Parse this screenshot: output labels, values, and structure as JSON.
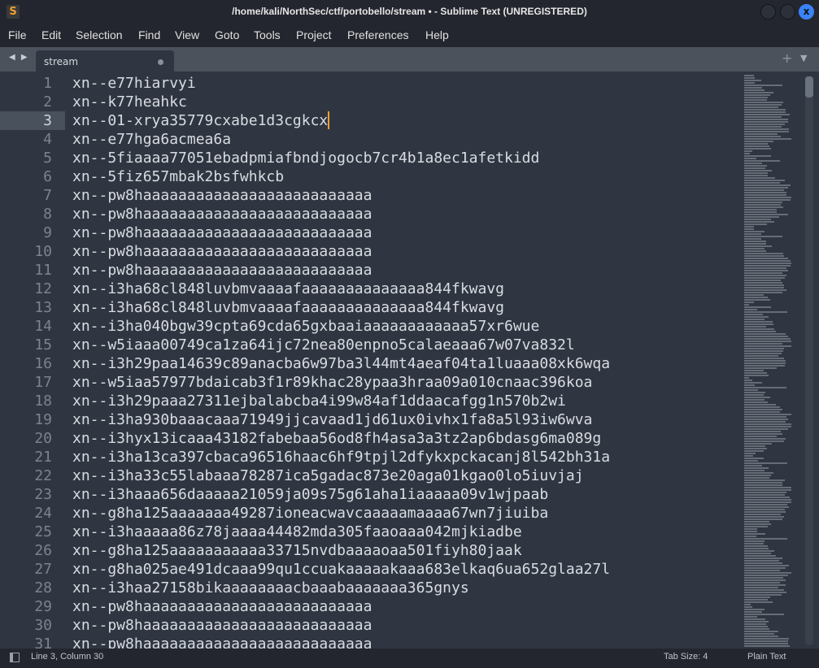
{
  "window": {
    "title": "/home/kali/NorthSec/ctf/portobello/stream • - Sublime Text (UNREGISTERED)",
    "app_icon": "S",
    "close_glyph": "x"
  },
  "menu": [
    "File",
    "Edit",
    "Selection",
    "Find",
    "View",
    "Goto",
    "Tools",
    "Project",
    "Preferences",
    "Help"
  ],
  "tabbar": {
    "nav_arrows": "◀ ▶",
    "tabs": [
      {
        "label": "stream",
        "modified": true
      }
    ],
    "new_tab": "+",
    "tab_menu": "▼"
  },
  "editor": {
    "active_line": 3,
    "lines": [
      {
        "n": "1",
        "text": "xn--e77hiarvyi"
      },
      {
        "n": "2",
        "text": "xn--k77heahkc"
      },
      {
        "n": "3",
        "text": "xn--01-xrya35779cxabe1d3cgkcx"
      },
      {
        "n": "4",
        "text": "xn--e77hga6acmea6a"
      },
      {
        "n": "5",
        "text": "xn--5fiaaaa77051ebadpmiafbndjogocb7cr4b1a8ec1afetkidd"
      },
      {
        "n": "6",
        "text": "xn--5fiz657mbak2bsfwhkcb"
      },
      {
        "n": "7",
        "text": "xn--pw8haaaaaaaaaaaaaaaaaaaaaaaaaa"
      },
      {
        "n": "8",
        "text": "xn--pw8haaaaaaaaaaaaaaaaaaaaaaaaaa"
      },
      {
        "n": "9",
        "text": "xn--pw8haaaaaaaaaaaaaaaaaaaaaaaaaa"
      },
      {
        "n": "10",
        "text": "xn--pw8haaaaaaaaaaaaaaaaaaaaaaaaaa"
      },
      {
        "n": "11",
        "text": "xn--pw8haaaaaaaaaaaaaaaaaaaaaaaaaa"
      },
      {
        "n": "12",
        "text": "xn--i3ha68cl848luvbmvaaaafaaaaaaaaaaaaaa844fkwavg"
      },
      {
        "n": "13",
        "text": "xn--i3ha68cl848luvbmvaaaafaaaaaaaaaaaaaa844fkwavg"
      },
      {
        "n": "14",
        "text": "xn--i3ha040bgw39cpta69cda65gxbaaiaaaaaaaaaaaa57xr6wue"
      },
      {
        "n": "15",
        "text": "xn--w5iaaa00749ca1za64ijc72nea80enpno5calaeaaa67w07va832l"
      },
      {
        "n": "16",
        "text": "xn--i3h29paa14639c89anacba6w97ba3l44mt4aeaf04ta1luaaa08xk6wqa"
      },
      {
        "n": "17",
        "text": "xn--w5iaa57977bdaicab3f1r89khac28ypaa3hraa09a010cnaac396koa"
      },
      {
        "n": "18",
        "text": "xn--i3h29paaa27311ejbalabcba4i99w84af1ddaacafgg1n570b2wi"
      },
      {
        "n": "19",
        "text": "xn--i3ha930baaacaaa71949jjcavaad1jd61ux0ivhx1fa8a5l93iw6wva"
      },
      {
        "n": "20",
        "text": "xn--i3hyx13icaaa43182fabebaa56od8fh4asa3a3tz2ap6bdasg6ma089g"
      },
      {
        "n": "21",
        "text": "xn--i3ha13ca397cbaca96516haac6hf9tpjl2dfykxpckacanj8l542bh31a"
      },
      {
        "n": "22",
        "text": "xn--i3ha33c55labaaa78287ica5gadac873e20aga01kgao0lo5iuvjaj"
      },
      {
        "n": "23",
        "text": "xn--i3haaa656daaaaa21059ja09s75g61aha1iaaaaa09v1wjpaab"
      },
      {
        "n": "24",
        "text": "xn--g8ha125aaaaaaa49287ioneacwavcaaaaamaaaa67wn7jiuiba"
      },
      {
        "n": "25",
        "text": "xn--i3haaaaa86z78jaaaa44482mda305faaoaaa042mjkiadbe"
      },
      {
        "n": "26",
        "text": "xn--g8ha125aaaaaaaaaaa33715nvdbaaaaoaa501fiyh80jaak"
      },
      {
        "n": "27",
        "text": "xn--g8ha025ae491dcaaa99qu1ccuakaaaaakaaa683elkaq6ua652glaa27l"
      },
      {
        "n": "28",
        "text": "xn--i3haa27158bikaaaaaaaacbaaabaaaaaaa365gnys"
      },
      {
        "n": "29",
        "text": "xn--pw8haaaaaaaaaaaaaaaaaaaaaaaaaa"
      },
      {
        "n": "30",
        "text": "xn--pw8haaaaaaaaaaaaaaaaaaaaaaaaaa"
      },
      {
        "n": "31",
        "text": "xn--pw8haaaaaaaaaaaaaaaaaaaaaaaaaa"
      }
    ]
  },
  "statusbar": {
    "position": "Line 3, Column 30",
    "tab_size": "Tab Size: 4",
    "syntax": "Plain Text"
  },
  "colors": {
    "caret": "#f0a030",
    "close_button": "#3b82f6",
    "editor_bg": "#303641"
  }
}
